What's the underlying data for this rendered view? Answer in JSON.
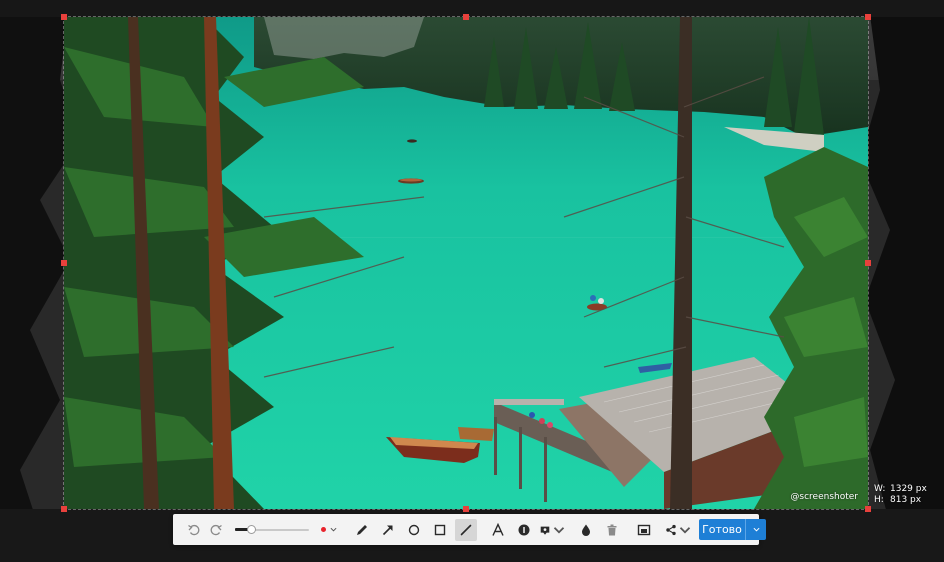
{
  "colors": {
    "accent": "#1e7fd6",
    "handle": "#e8413c",
    "pen_color": "#e8232c",
    "toolbar_bg": "#f3f3f3"
  },
  "selection": {
    "width_label": "W:",
    "width_value": "1329 px",
    "height_label": "H:",
    "height_value": "813 px",
    "watermark": "@screenshoter"
  },
  "toolbar": {
    "tools": [
      {
        "name": "undo",
        "icon": "undo-icon"
      },
      {
        "name": "redo",
        "icon": "redo-icon"
      },
      {
        "name": "line-thickness",
        "icon": "slider"
      },
      {
        "name": "color",
        "icon": "color-dot"
      },
      {
        "name": "pencil",
        "icon": "pencil-icon"
      },
      {
        "name": "arrow",
        "icon": "arrow-icon"
      },
      {
        "name": "ellipse",
        "icon": "circle-icon"
      },
      {
        "name": "rectangle",
        "icon": "square-icon"
      },
      {
        "name": "marker",
        "icon": "marker-icon",
        "active": true
      },
      {
        "name": "text",
        "icon": "text-icon"
      },
      {
        "name": "counter",
        "icon": "counter-icon"
      },
      {
        "name": "stamp",
        "icon": "stamp-icon"
      },
      {
        "name": "blur",
        "icon": "drop-icon"
      },
      {
        "name": "delete",
        "icon": "trash-icon"
      },
      {
        "name": "screenshot-copy",
        "icon": "screen-icon"
      },
      {
        "name": "share",
        "icon": "share-icon"
      }
    ],
    "thickness_level": 0.22,
    "done_label": "Готово"
  }
}
